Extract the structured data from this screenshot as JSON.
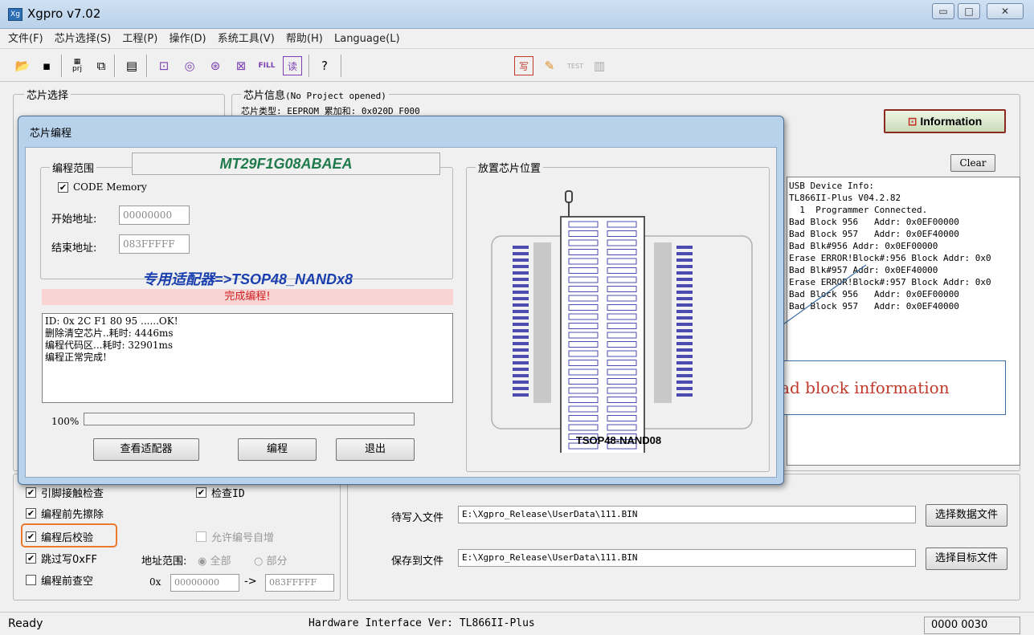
{
  "window": {
    "title": "Xgpro v7.02",
    "icon": "app-icon"
  },
  "menu": [
    "文件(F)",
    "芯片选择(S)",
    "工程(P)",
    "操作(D)",
    "系统工具(V)",
    "帮助(H)",
    "Language(L)"
  ],
  "toolbar": {
    "prj_label": "prj",
    "fill_label": "FILL",
    "test_label": "TEST",
    "read_label": "读",
    "write_label": "写"
  },
  "chip_select": {
    "label": "芯片选择"
  },
  "chip_info": {
    "label": "芯片信息",
    "project": "(No Project opened)",
    "row1": "芯片类型: EEPROM    累加和: 0x020D_F000"
  },
  "info_button": "Information",
  "clear_button": "Clear",
  "log_lines": [
    "USB Device Info:",
    "TL866II-Plus V04.2.82",
    "  1  Programmer Connected.",
    "Bad Block 956   Addr: 0x0EF00000",
    "Bad Block 957   Addr: 0x0EF40000",
    "Bad Blk#956 Addr: 0x0EF00000",
    "Erase ERROR!Block#:956 Block Addr: 0x0",
    "Bad Blk#957 Addr: 0x0EF40000",
    "Erase ERROR!Block#:957 Block Addr: 0x0",
    "Bad Block 956   Addr: 0x0EF00000",
    "Bad Block 957   Addr: 0x0EF40000"
  ],
  "callout": "Bad block information",
  "options": {
    "pin_check": "引脚接触检查",
    "check_id": "检查ID",
    "erase_before": "编程前先擦除",
    "verify_after": "编程后校验",
    "auto_serial": "允许编号自增",
    "skip_ff": "跳过写0xFF",
    "addr_range": "地址范围:",
    "all": "全部",
    "part": "部分",
    "blank_check": "编程前查空",
    "addr_prefix": "0x",
    "addr_from": "00000000",
    "addr_arrow": "->",
    "addr_to": "083FFFFF"
  },
  "files": {
    "write_label": "待写入文件",
    "write_path": "E:\\Xgpro_Release\\UserData\\111.BIN",
    "write_btn": "选择数据文件",
    "save_label": "保存到文件",
    "save_path": "E:\\Xgpro_Release\\UserData\\111.BIN",
    "save_btn": "选择目标文件"
  },
  "status": {
    "ready": "Ready",
    "hw": "Hardware Interface Ver: TL866II-Plus",
    "code": "0000 0030"
  },
  "dialog": {
    "title": "芯片编程",
    "range_label": "编程范围",
    "chip_name": "MT29F1G08ABAEA",
    "code_memory": "CODE Memory",
    "start_label": "开始地址:",
    "start_value": "00000000",
    "end_label": "结束地址:",
    "end_value": "083FFFFF",
    "adapter": "专用适配器=>TSOP48_NANDx8",
    "status": "完成编程!",
    "log": [
      "ID: 0x 2C F1 80 95 ......OK!",
      "删除清空芯片..耗时: 4446ms",
      "编程代码区...耗时: 32901ms",
      "编程正常完成!"
    ],
    "progress_label": "100%",
    "progress": 0,
    "btn_view": "查看适配器",
    "btn_program": "编程",
    "btn_exit": "退出",
    "place_label": "放置芯片位置",
    "package": "TSOP48-NAND08"
  }
}
